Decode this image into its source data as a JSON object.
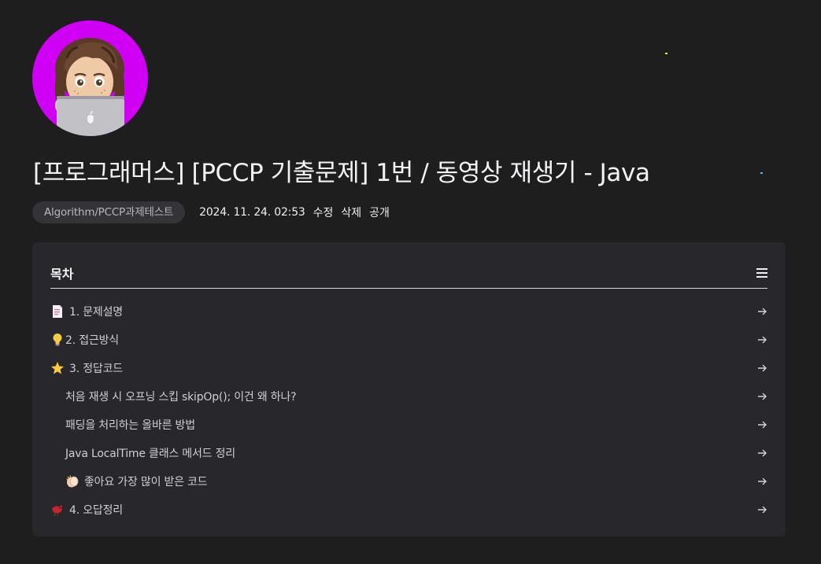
{
  "post": {
    "title": "[프로그래머스] [PCCP 기출문제] 1번 / 동영상 재생기 - Java",
    "category": "Algorithm/PCCP과제테스트",
    "date": "2024. 11. 24. 02:53",
    "actions": {
      "edit": "수정",
      "delete": "삭제",
      "visibility": "공개"
    }
  },
  "profile": {
    "avatar_icon": "memoji-laptop-avatar",
    "avatar_bg": "#d000f5"
  },
  "toc": {
    "title": "목차",
    "menu_icon": "hamburger-icon",
    "items": [
      {
        "icon": "page-facing-up-icon",
        "label": "1. 문제설명",
        "level": 1
      },
      {
        "icon": "light-bulb-icon",
        "label": "2. 접근방식",
        "level": 1
      },
      {
        "icon": "star-icon",
        "label": "3. 정답코드",
        "level": 1
      },
      {
        "icon": "",
        "label": "처음 재생 시 오프닝 스킵 skipOp(); 이건 왜 하나?",
        "level": 2
      },
      {
        "icon": "",
        "label": "패딩을 처리하는 올바른 방법",
        "level": 2
      },
      {
        "icon": "",
        "label": "Java LocalTime 클래스 메서드 정리",
        "level": 2
      },
      {
        "icon": "clapping-hands-icon",
        "label": "좋아요 가장 많이 받은 코드",
        "level": 2
      },
      {
        "icon": "bird-icon",
        "label": "4. 오답정리",
        "level": 1
      }
    ],
    "arrow_icon": "arrow-right-icon"
  },
  "colors": {
    "background": "#1e1e1f",
    "toc_background": "#28282c",
    "chip_background": "#343438",
    "text_primary": "#f3f3f5",
    "text_secondary": "#cfcfd3"
  }
}
